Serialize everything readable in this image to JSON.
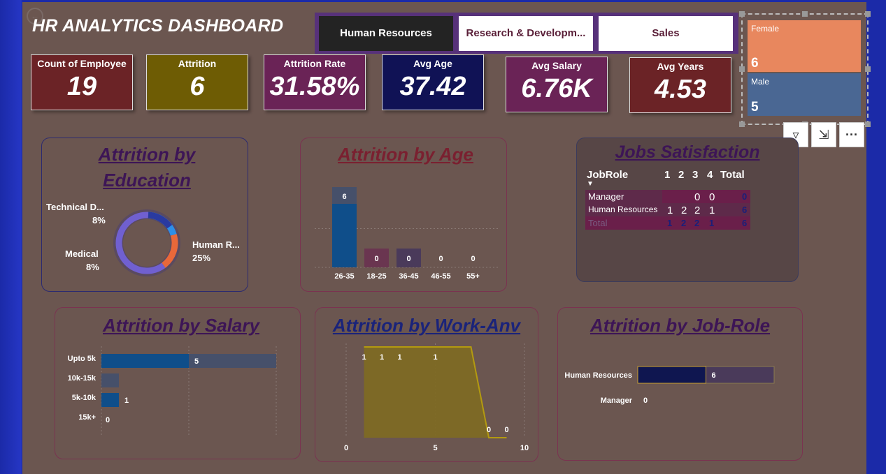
{
  "title": "HR ANALYTICS DASHBOARD",
  "slicer": [
    "Human Resources",
    "Research & Developm...",
    "Sales"
  ],
  "kpis": [
    {
      "label": "Count of Employee",
      "value": "19",
      "color": "#6b2326"
    },
    {
      "label": "Attrition",
      "value": "6",
      "color": "#6e5c04"
    },
    {
      "label": "Attrition Rate",
      "value": "31.58%",
      "color": "#6a2356"
    },
    {
      "label": "Avg Age",
      "value": "37.42",
      "color": "#101255"
    },
    {
      "label": "Avg Salary",
      "value": "6.76K",
      "color": "#6a2356"
    },
    {
      "label": "Avg Years",
      "value": "4.53",
      "color": "#6b2326"
    }
  ],
  "gender": {
    "female_label": "Female",
    "female_value": "6",
    "female_color": "#e8875e",
    "male_label": "Male",
    "male_value": "5",
    "male_color": "#4a6793"
  },
  "cards": {
    "education_title_1": "Attrition by",
    "education_title_2": "Education",
    "age_title": "Attrition by Age",
    "jobs_title": "Jobs Satisfaction",
    "salary_title": "Attrition by Salary",
    "workanv_title": "Attrition by Work-Anv",
    "jobrole_title": "Attrition by Job-Role"
  },
  "education_labels": [
    {
      "name": "Technical D...",
      "pct": "8%"
    },
    {
      "name": "Medical",
      "pct": "8%"
    },
    {
      "name": "Human R...",
      "pct": "25%"
    }
  ],
  "job_satisfaction": {
    "headers": [
      "JobRole",
      "1",
      "2",
      "3",
      "4",
      "Total"
    ],
    "rows": [
      {
        "role": "Manager",
        "c1": "",
        "c2": "",
        "c3": "0",
        "c4": "0",
        "total": "0"
      },
      {
        "role": "Human Resources",
        "c1": "1",
        "c2": "2",
        "c3": "2",
        "c4": "1",
        "total": "6"
      }
    ],
    "total_row": {
      "role": "Total",
      "c1": "1",
      "c2": "2",
      "c3": "2",
      "c4": "1",
      "total": "6"
    }
  },
  "chart_data": [
    {
      "type": "pie",
      "title": "Attrition by Education",
      "categories": [
        "Technical D...",
        "Medical",
        "Human R..."
      ],
      "values": [
        8,
        8,
        25
      ],
      "colors": [
        "#2d8fe8",
        "#e8683a",
        "#7060d0"
      ]
    },
    {
      "type": "bar",
      "title": "Attrition by Age",
      "categories": [
        "26-35",
        "18-25",
        "36-45",
        "46-55",
        "55+"
      ],
      "values": [
        6,
        0,
        0,
        0,
        0
      ],
      "bar_color": "#0f4e8a"
    },
    {
      "type": "bar",
      "title": "Attrition by Salary",
      "categories": [
        "Upto 5k",
        "10k-15k",
        "5k-10k",
        "15k+"
      ],
      "values": [
        5,
        null,
        1,
        0
      ],
      "bar_color": "#0f4e8a"
    },
    {
      "type": "area",
      "title": "Attrition by Work-Anv",
      "x": [
        1,
        2,
        3,
        5,
        6,
        7,
        8,
        9
      ],
      "y": [
        1,
        1,
        1,
        1,
        1,
        1,
        0,
        0
      ],
      "point_labels": [
        "1",
        "1",
        "1",
        "1",
        "",
        "",
        "0",
        "0"
      ],
      "x_ticks": [
        "0",
        "5",
        "10"
      ],
      "xlim": [
        0,
        10
      ],
      "fill_color": "#7e6a24",
      "line_color": "#b39a10"
    },
    {
      "type": "bar",
      "title": "Attrition by Job-Role",
      "categories": [
        "Human Resources",
        "Manager"
      ],
      "values": [
        6,
        0
      ],
      "bar_color": "#0f1650"
    }
  ]
}
